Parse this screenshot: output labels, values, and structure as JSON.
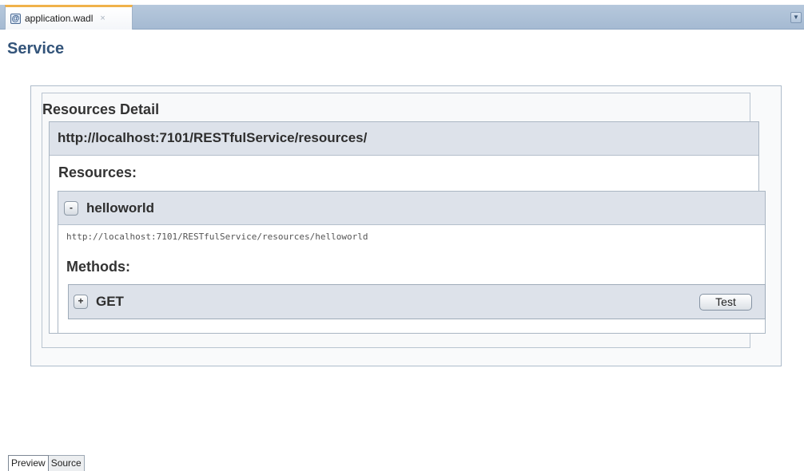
{
  "editor": {
    "tab_label": "application.wadl",
    "tab_icon": "@",
    "tab_close": "×"
  },
  "page": {
    "title": "Service"
  },
  "resources_detail": {
    "title": "Resources Detail",
    "base_url": "http://localhost:7101/RESTfulService/resources/",
    "resources_label": "Resources:",
    "resource": {
      "name": "helloworld",
      "toggle": "-",
      "url": "http://localhost:7101/RESTfulService/resources/helloworld",
      "methods_label": "Methods:",
      "method": {
        "name": "GET",
        "toggle": "+",
        "test_label": "Test"
      }
    }
  },
  "bottom_tabs": {
    "preview": "Preview",
    "source": "Source"
  },
  "colors": {
    "title": "#33547a",
    "header_bg": "#dde2ea",
    "tab_accent": "#f0b24a"
  }
}
